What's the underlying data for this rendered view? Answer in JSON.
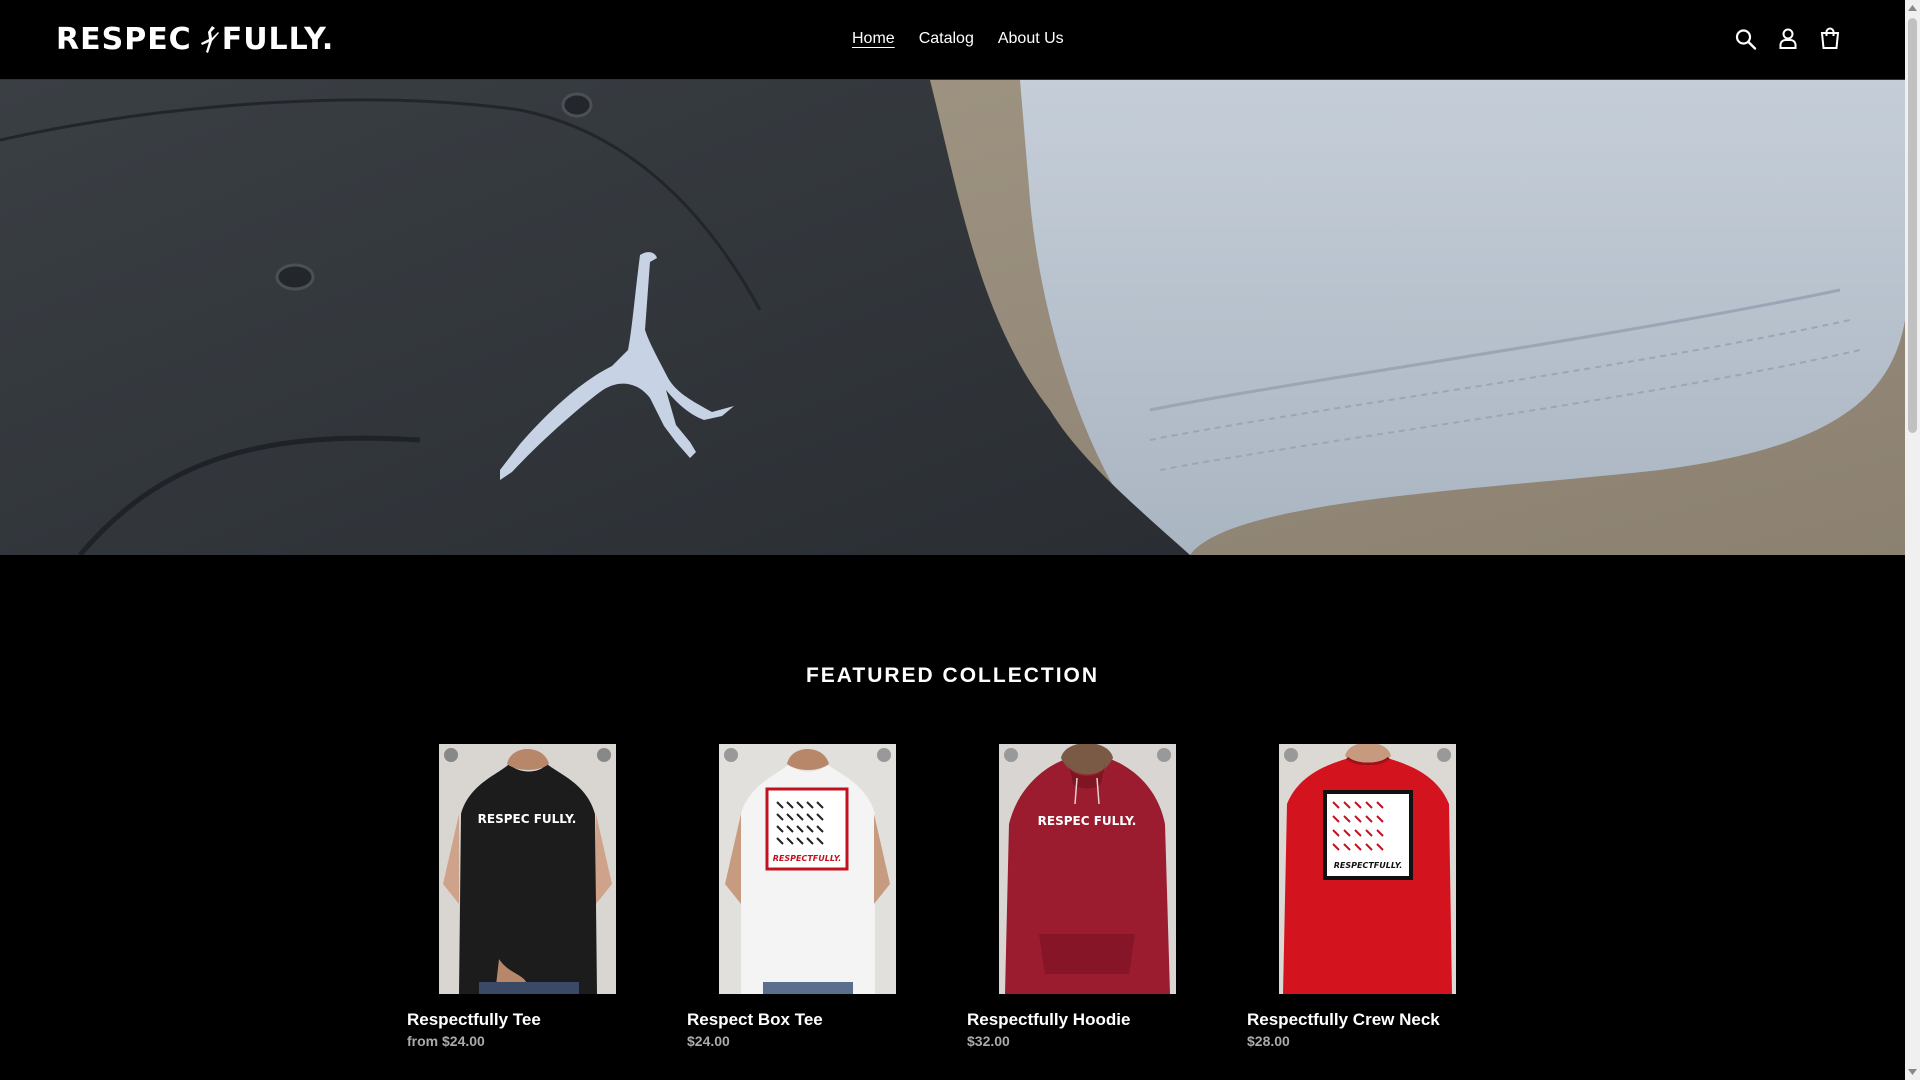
{
  "header": {
    "logo_text_left": "RESPEC",
    "logo_text_right": "FULLY.",
    "nav": [
      {
        "label": "Home",
        "active": true
      },
      {
        "label": "Catalog",
        "active": false
      },
      {
        "label": "About Us",
        "active": false
      }
    ],
    "icons": [
      "search-icon",
      "account-icon",
      "cart-icon"
    ]
  },
  "hero": {
    "slides_total": 4,
    "active_slide": 1
  },
  "featured": {
    "title": "FEATURED COLLECTION",
    "products": [
      {
        "name": "Respectfully Tee",
        "price": "from $24.00",
        "shirt_color": "#1c1c1c",
        "print": "RESPEC FULLY."
      },
      {
        "name": "Respect Box Tee",
        "price": "$24.00",
        "shirt_color": "#f4f4f4",
        "print": "RESPECTFULLY."
      },
      {
        "name": "Respectfully Hoodie",
        "price": "$32.00",
        "shirt_color": "#9a1c2e",
        "print": "RESPEC FULLY."
      },
      {
        "name": "Respectfully Crew Neck",
        "price": "$28.00",
        "shirt_color": "#d3141f",
        "print": "RESPECTFULLY."
      }
    ]
  },
  "colors": {
    "background": "#000000",
    "header": "#000000",
    "price_text": "#aaaaaa"
  }
}
